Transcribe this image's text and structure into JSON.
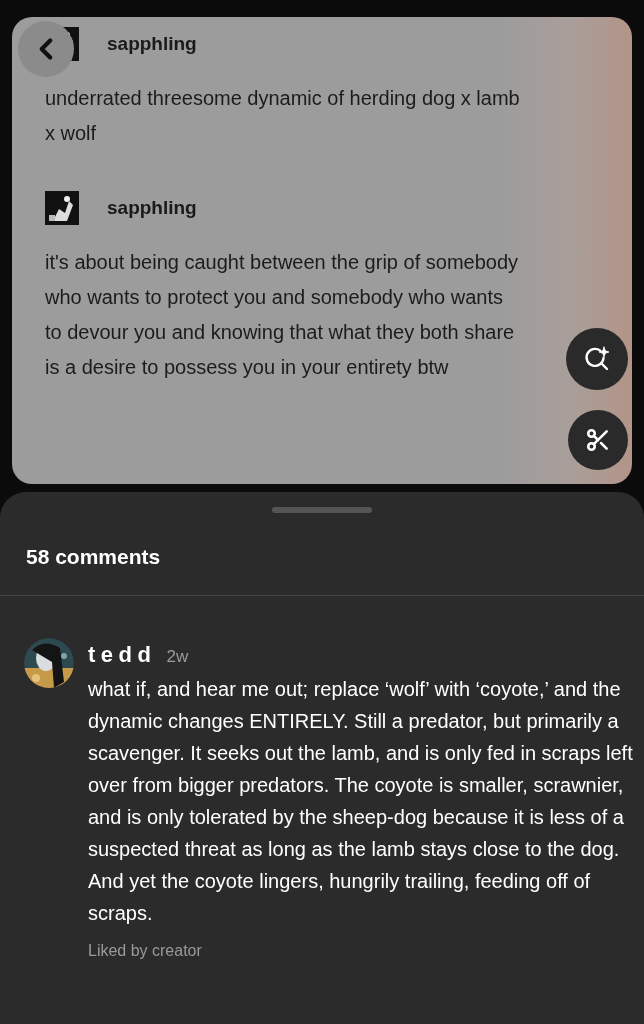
{
  "post": {
    "entries": [
      {
        "username": "sapphling",
        "text": "underrated threesome dynamic of herding dog x lamb x wolf"
      },
      {
        "username": "sapphling",
        "text": "it's about being caught between the grip of somebody who wants to protect you and somebody who wants to devour you and knowing that what they both share is a desire to possess you in your entirety btw"
      }
    ]
  },
  "comments_sheet": {
    "count_label": "58 comments",
    "comments": [
      {
        "author": "tedd",
        "time": "2w",
        "text": "what if, and hear me out; replace ‘wolf’ with ‘coyote,’ and the dynamic changes ENTIRELY. Still a predator, but primarily a scavenger. It seeks out the lamb, and is only fed in scraps left over from bigger predators. The coyote is smaller, scrawnier, and is only tolerated by the sheep-dog because it is less of a suspected threat as long as the lamb stays close to the dog. And yet the coyote lingers, hungrily trailing, feeding off of scraps.",
        "liked_by": "Liked by creator"
      }
    ]
  }
}
